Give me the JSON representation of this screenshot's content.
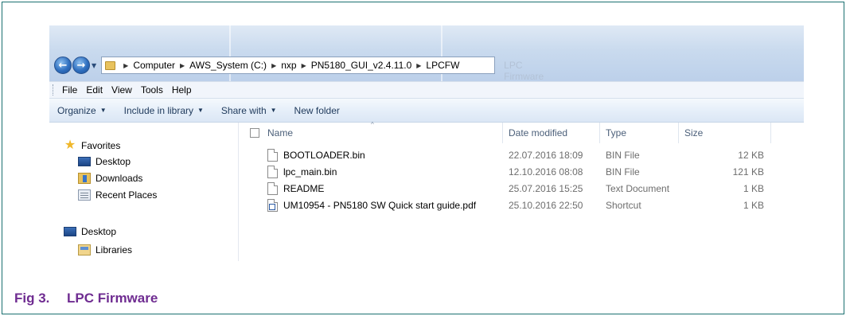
{
  "address_bar": {
    "breadcrumbs": [
      "Computer",
      "AWS_System (C:)",
      "nxp",
      "PN5180_GUI_v2.4.11.0",
      "LPCFW"
    ],
    "search_placeholder": "LPC Firmware"
  },
  "menubar": {
    "items": [
      "File",
      "Edit",
      "View",
      "Tools",
      "Help"
    ]
  },
  "toolbar": {
    "organize": "Organize",
    "include_in_library": "Include in library",
    "share_with": "Share with",
    "new_folder": "New folder"
  },
  "sidebar": {
    "favorites": "Favorites",
    "items": [
      "Desktop",
      "Downloads",
      "Recent Places"
    ],
    "desktop": "Desktop",
    "libraries": "Libraries"
  },
  "file_list": {
    "columns": {
      "name": "Name",
      "date": "Date modified",
      "type": "Type",
      "size": "Size"
    },
    "rows": [
      {
        "name": "BOOTLOADER.bin",
        "date": "22.07.2016 18:09",
        "type": "BIN File",
        "size": "12 KB",
        "icon": "file-icon"
      },
      {
        "name": "lpc_main.bin",
        "date": "12.10.2016 08:08",
        "type": "BIN File",
        "size": "121 KB",
        "icon": "file-icon"
      },
      {
        "name": "README",
        "date": "25.07.2016 15:25",
        "type": "Text Document",
        "size": "1 KB",
        "icon": "file-icon"
      },
      {
        "name": "UM10954 - PN5180 SW Quick start guide.pdf",
        "date": "25.10.2016 22:50",
        "type": "Shortcut",
        "size": "1 KB",
        "icon": "shortcut-icon"
      }
    ]
  },
  "caption": {
    "number": "Fig 3.",
    "title": "LPC Firmware"
  },
  "colors": {
    "frame": "#1a6f70",
    "caption": "#6f2c91"
  }
}
